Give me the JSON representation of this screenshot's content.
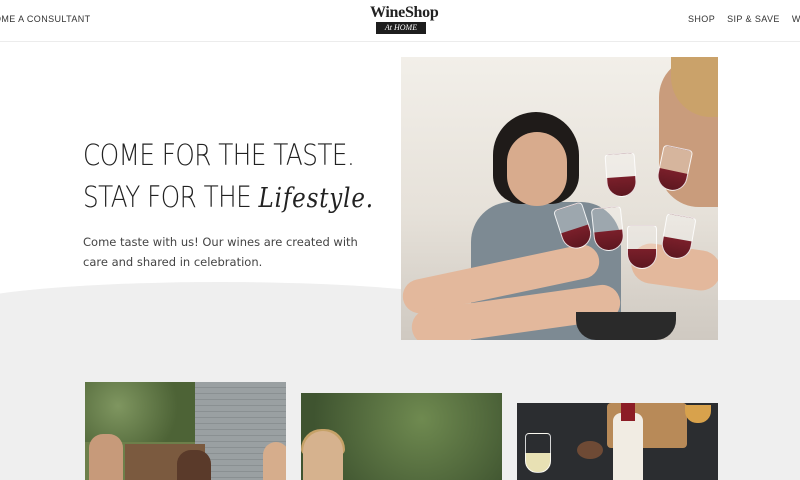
{
  "header": {
    "nav_left": "OME A CONSULTANT",
    "logo_top": "WineShop",
    "logo_bottom": "At HOME",
    "nav_right": [
      "SHOP",
      "SIP & SAVE",
      "WINE C"
    ]
  },
  "hero": {
    "headline_line1": "COME FOR THE TASTE.",
    "headline_line2_prefix": "STAY FOR THE ",
    "headline_script": "Lifestyle.",
    "body": "Come taste with us! Our wines are created with care and shared in celebration.",
    "photo_icon": "toast-photo"
  },
  "cards": [
    {
      "icon": "friends-outdoor-photo"
    },
    {
      "icon": "woman-outdoor-photo"
    },
    {
      "icon": "wine-table-photo"
    }
  ]
}
